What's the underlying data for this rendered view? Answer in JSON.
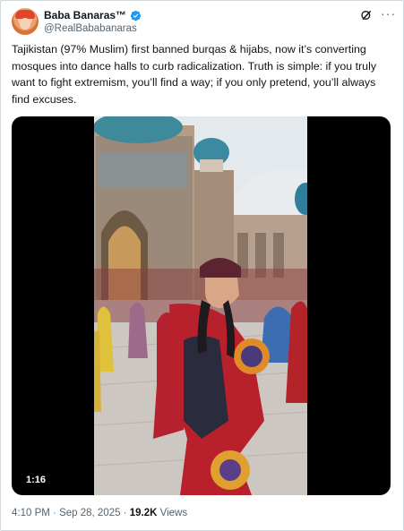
{
  "author": {
    "name": "Baba Banaras™",
    "handle": "@RealBababanaras",
    "verified_color": "#1d9bf0"
  },
  "header_icons": [
    "grok-icon",
    "more-options-icon"
  ],
  "more_label": "···",
  "tweet": {
    "text": "Tajikistan (97% Muslim) first banned burqas & hijabs, now it’s converting mosques into dance halls to curb radicalization. Truth is simple: if you truly want to fight extremism, you’ll find a way; if you only pretend, you’ll always find excuses."
  },
  "media": {
    "duration": "1:16"
  },
  "meta": {
    "time": "4:10 PM",
    "separator1": " · ",
    "date": "Sep 28, 2025",
    "separator2": " · ",
    "views_count": "19.2K",
    "views_label": " Views"
  }
}
